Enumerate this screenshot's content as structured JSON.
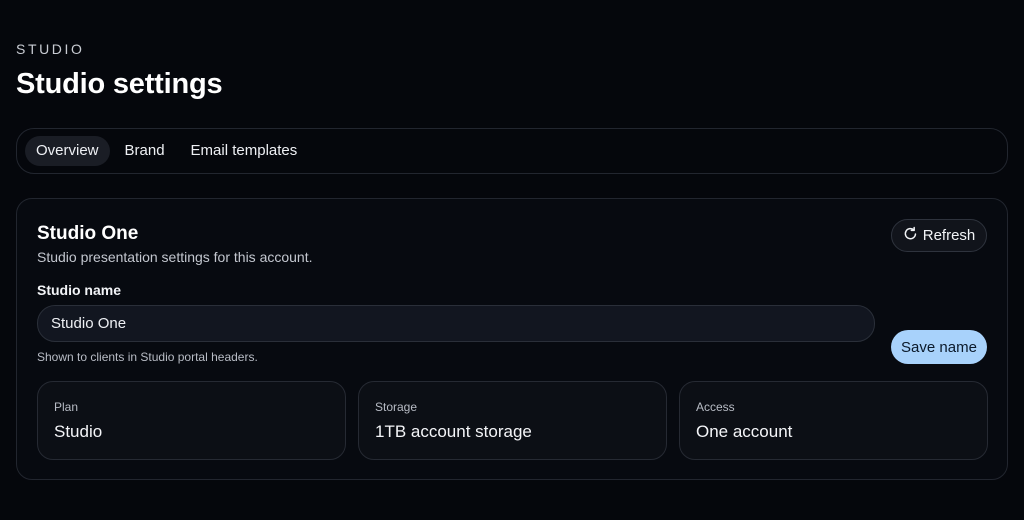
{
  "header": {
    "eyebrow": "STUDIO",
    "title": "Studio settings"
  },
  "tabs": [
    {
      "label": "Overview",
      "active": true
    },
    {
      "label": "Brand",
      "active": false
    },
    {
      "label": "Email templates",
      "active": false
    }
  ],
  "card": {
    "title": "Studio One",
    "description": "Studio presentation settings for this account.",
    "refresh_label": "Refresh",
    "refresh_icon": "refresh-icon",
    "field_label": "Studio name",
    "field_value": "Studio One",
    "helper_text": "Shown to clients in Studio portal headers.",
    "save_label": "Save name"
  },
  "stats": [
    {
      "label": "Plan",
      "value": "Studio"
    },
    {
      "label": "Storage",
      "value": "1TB account storage"
    },
    {
      "label": "Access",
      "value": "One account"
    }
  ],
  "colors": {
    "background": "#05070c",
    "primary_button": "#a8d2fb",
    "active_tab": "#1a1d25"
  }
}
